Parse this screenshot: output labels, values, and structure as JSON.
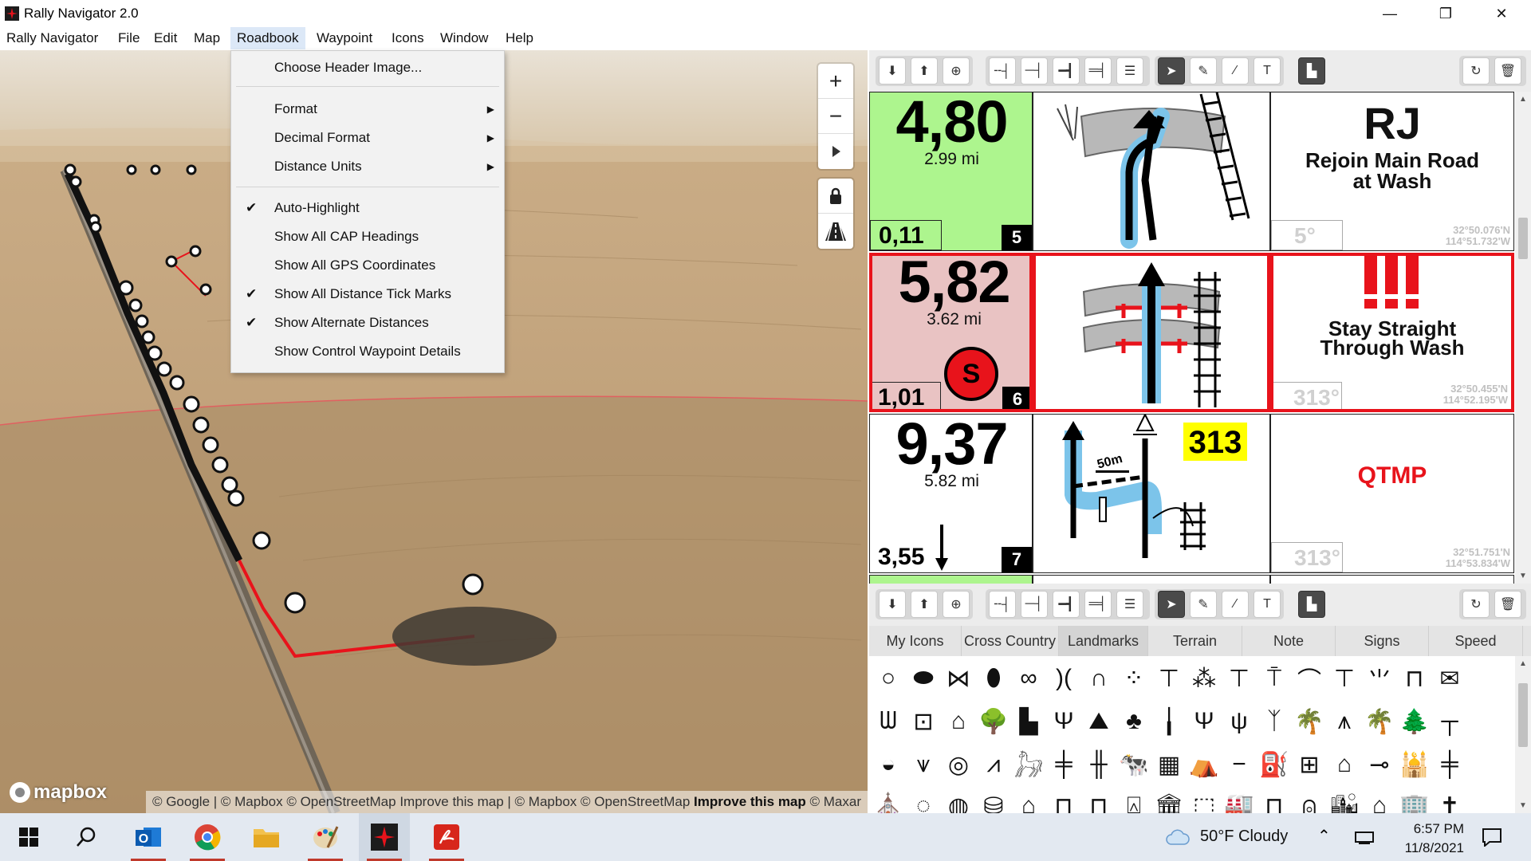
{
  "window": {
    "title": "Rally Navigator 2.0",
    "minimize": "—",
    "restore": "❐",
    "close": "✕"
  },
  "menubar": [
    "Rally Navigator",
    "File",
    "Edit",
    "Map",
    "Roadbook",
    "Waypoint",
    "Icons",
    "Window",
    "Help"
  ],
  "roadbook_menu": {
    "choose_header": "Choose Header Image...",
    "format": "Format",
    "decimal_format": "Decimal Format",
    "distance_units": "Distance Units",
    "auto_highlight": "Auto-Highlight",
    "show_cap": "Show All CAP Headings",
    "show_gps": "Show All GPS Coordinates",
    "show_tick": "Show All Distance Tick Marks",
    "show_alt": "Show Alternate Distances",
    "show_control": "Show Control Waypoint Details",
    "checked": [
      "auto_highlight",
      "show_tick",
      "show_alt"
    ]
  },
  "map": {
    "zoom_in": "+",
    "zoom_out": "−",
    "logo": "mapbox",
    "attribution_start": "© Google | © Mapbox © OpenStreetMap Improve this map | © Mapbox © OpenStreetMap",
    "attribution_bold": "Improve this map",
    "attribution_end": "© Maxar"
  },
  "roadbook": {
    "rows": [
      {
        "total": "4,80",
        "miles": "2.99 mi",
        "partial": "0,11",
        "number": "5",
        "heading": "5°",
        "gps_lat": "32°50.076'N",
        "gps_lon": "114°51.732'W",
        "note_code": "RJ",
        "note_text_1": "Rejoin Main Road",
        "note_text_2": "at Wash"
      },
      {
        "total": "5,82",
        "miles": "3.62 mi",
        "partial": "1,01",
        "number": "6",
        "heading": "313°",
        "gps_lat": "32°50.455'N",
        "gps_lon": "114°52.195'W",
        "speed_badge": "S",
        "note_text_1": "Stay Straight",
        "note_text_2": "Through Wash"
      },
      {
        "total": "9,37",
        "miles": "5.82 mi",
        "partial": "3,55",
        "number": "7",
        "heading": "313°",
        "gps_lat": "32°51.751'N",
        "gps_lon": "114°53.834'W",
        "cap_label": "313",
        "dist_label": "50m",
        "note_code": "QTMP"
      }
    ]
  },
  "icon_tabs": [
    "My Icons",
    "Cross Country",
    "Landmarks",
    "Terrain",
    "Note",
    "Signs",
    "Speed"
  ],
  "taskbar": {
    "weather": "50°F  Cloudy",
    "time": "6:57 PM",
    "date": "11/8/2021"
  },
  "colors": {
    "highlight_green": "#adf58e",
    "highlight_red_bg": "#e9c3c3",
    "accent_red": "#e8131b",
    "cap_yellow": "#ffff00",
    "route_blue": "#7cc4ea"
  }
}
